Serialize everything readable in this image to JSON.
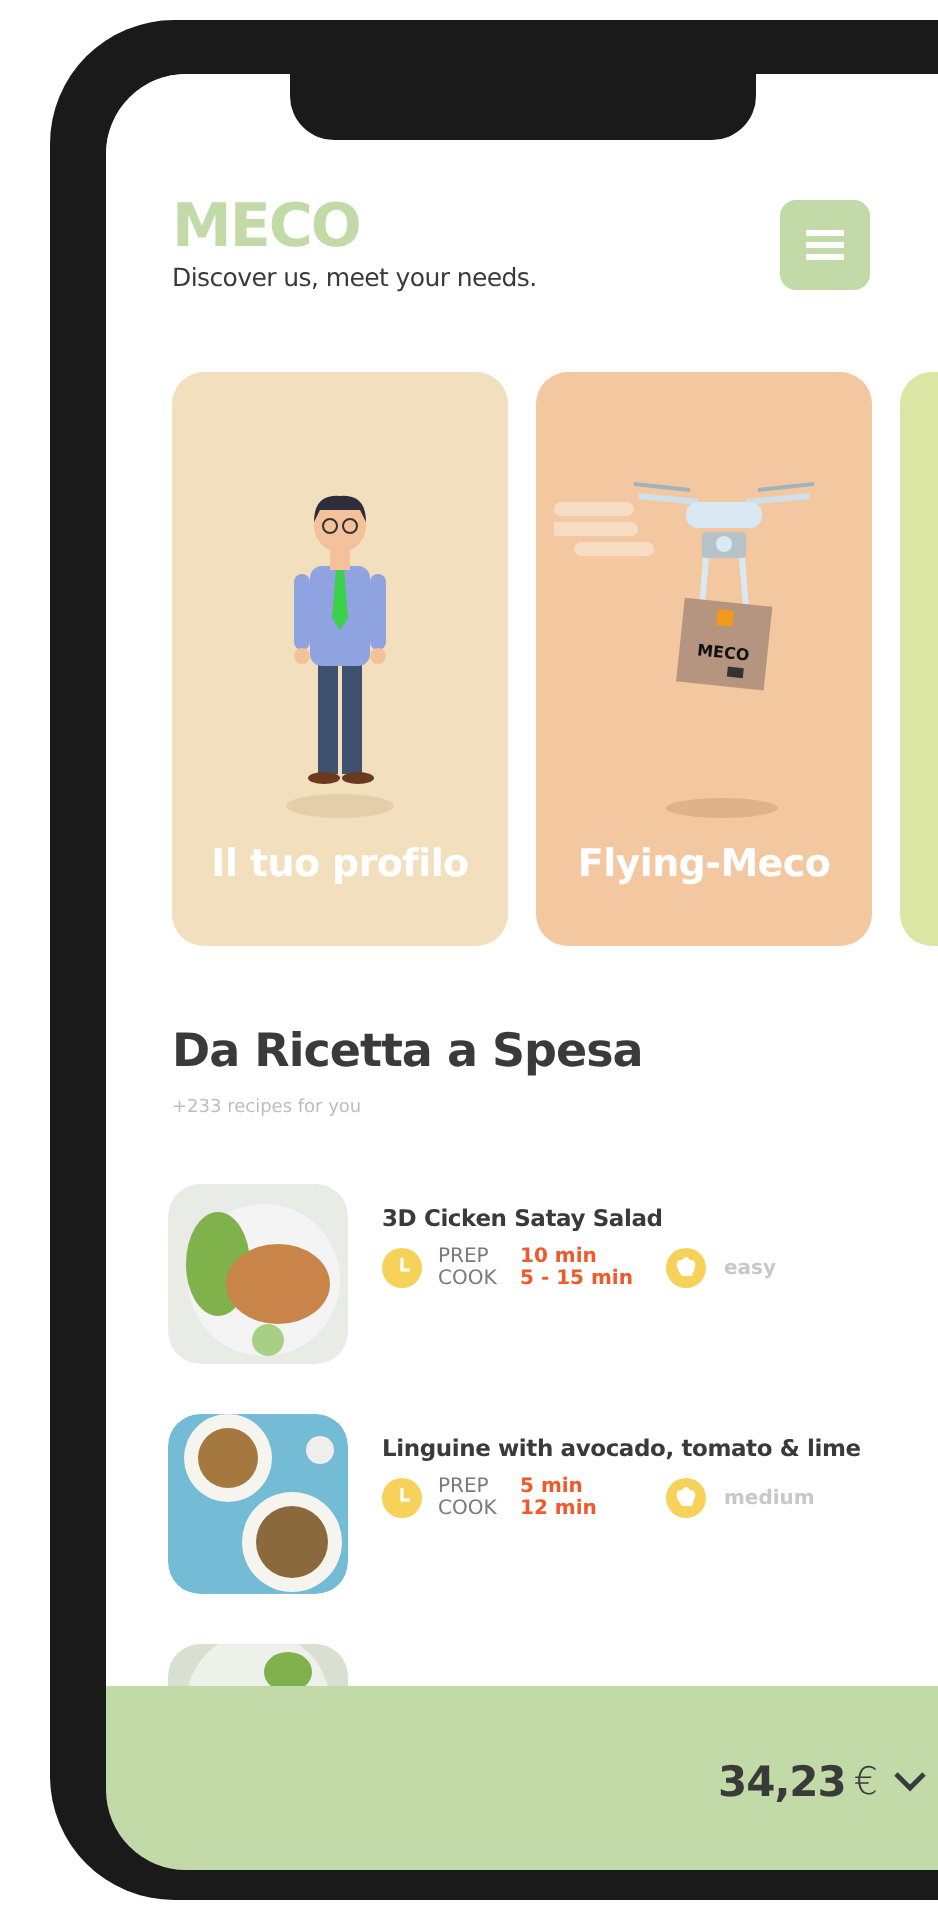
{
  "brand": {
    "logo": "MECO",
    "tagline": "Discover us, meet your needs."
  },
  "cards": [
    {
      "kind": "profile",
      "title": "Il tuo profilo",
      "color": "#f2dfbd"
    },
    {
      "kind": "drone",
      "title": "Flying-Meco",
      "color": "#f3c7a0",
      "box_label": "MECO"
    },
    {
      "kind": "blank",
      "color": "#dce6a4"
    }
  ],
  "section": {
    "title": "Da Ricetta a Spesa",
    "subtitle": "+233 recipes for you"
  },
  "recipes": [
    {
      "kind": "salad",
      "title": "3D Cicken Satay Salad",
      "prep_label": "PREP",
      "prep": "10 min",
      "cook_label": "COOK",
      "cook": "5 - 15 min",
      "difficulty": "easy"
    },
    {
      "kind": "pasta",
      "title": "Linguine with avocado, tomato & lime",
      "prep_label": "PREP",
      "prep": "5 min",
      "cook_label": "COOK",
      "cook": "12 min",
      "difficulty": "medium"
    },
    {
      "kind": "greens"
    }
  ],
  "cart": {
    "total": "34,23",
    "currency": "€"
  }
}
